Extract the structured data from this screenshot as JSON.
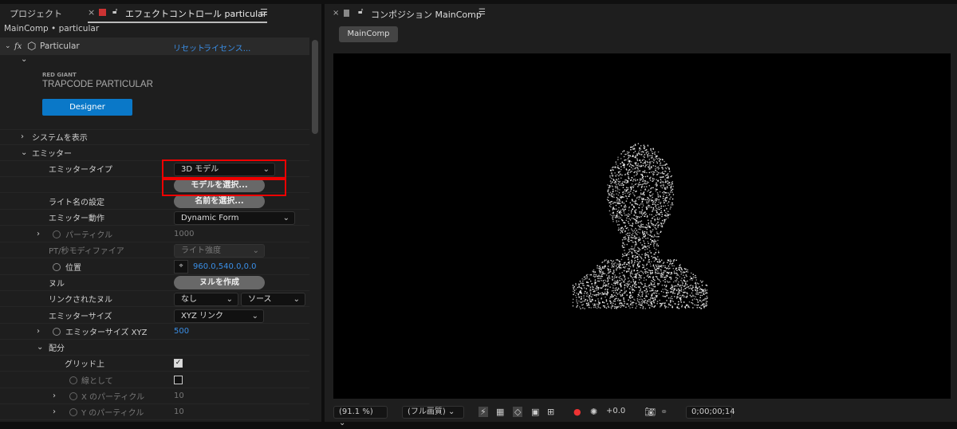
{
  "left_panel": {
    "tab_project": "プロジェクト",
    "tab_effect": "エフェクトコントロール particular",
    "breadcrumb": "MainComp • particular",
    "effect_name": "Particular",
    "reset": "リセット",
    "license": "ライセンス...",
    "brand_small": "RED GIANT",
    "brand_big": "TRAPCODE PARTICULAR",
    "designer": "Designer",
    "rows": {
      "show_system": "システムを表示",
      "emitter": "エミッター",
      "emitter_type": "エミッタータイプ",
      "emitter_type_value": "3D モデル",
      "choose_model": "モデルを選択...",
      "light_name": "ライト名の設定",
      "choose_name": "名前を選択...",
      "emitter_behavior": "エミッター動作",
      "emitter_behavior_value": "Dynamic Form",
      "particles": "パーティクル",
      "particles_value": "1000",
      "pt_modifier": "PT/秒モディファイア",
      "pt_modifier_value": "ライト強度",
      "position": "位置",
      "position_value": "960.0,540.0,0.0",
      "null": "ヌル",
      "create_null": "ヌルを作成",
      "linked_null": "リンクされたヌル",
      "linked_null_value": "なし",
      "linked_source_value": "ソース",
      "emitter_size": "エミッターサイズ",
      "emitter_size_value": "XYZ リンク",
      "emitter_size_xyz": "エミッターサイズ XYZ",
      "emitter_size_xyz_value": "500",
      "distribution": "配分",
      "on_grid": "グリッド上",
      "on_grid_checked": true,
      "as_lines": "線として",
      "as_lines_checked": false,
      "x_particles": "X のパーティクル",
      "x_particles_value": "10",
      "y_particles": "Y のパーティクル",
      "y_particles_value": "10"
    }
  },
  "right_panel": {
    "tab_title": "コンポジション MainComp",
    "comp_button": "MainComp",
    "zoom": "(91.1 %)",
    "resolution": "(フル画質)",
    "exposure": "+0.0",
    "timecode": "0;00;00;14"
  },
  "colors": {
    "accent": "#3a8ee6",
    "designer": "#0a78c8",
    "highlight": "#ee0000"
  }
}
